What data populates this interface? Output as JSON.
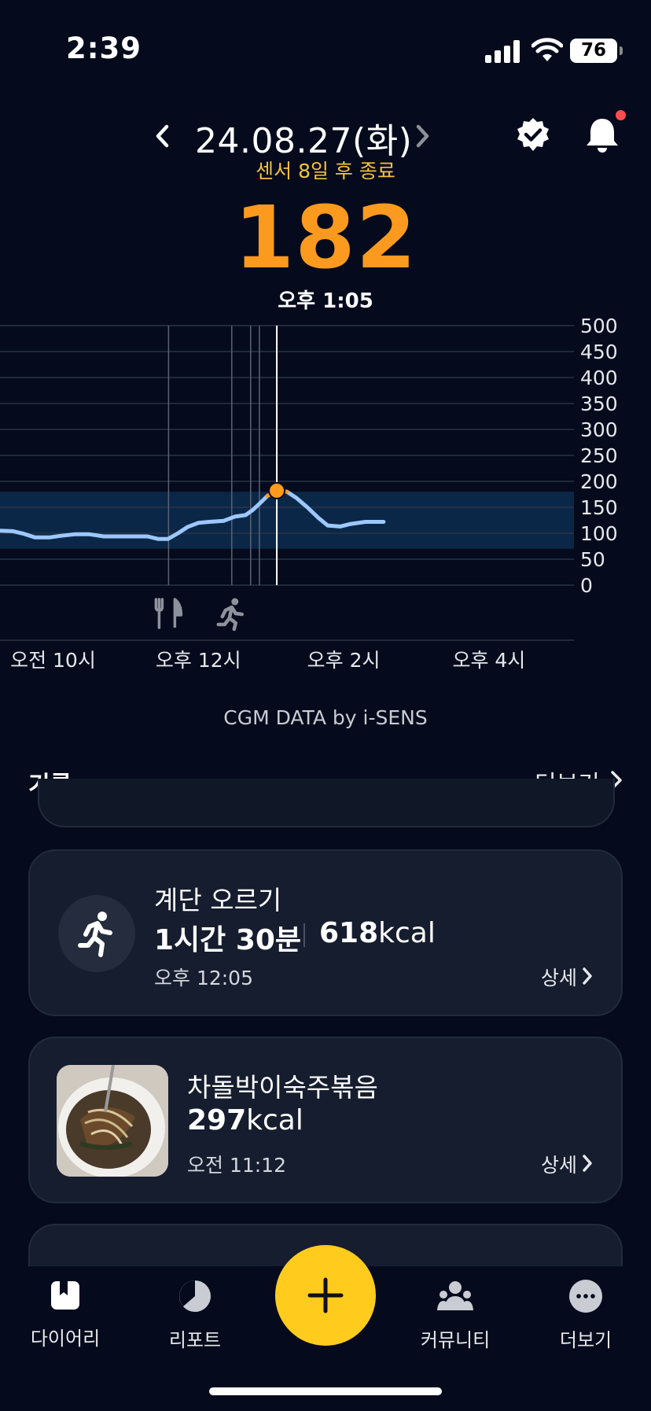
{
  "status_bar": {
    "time": "2:39",
    "battery": "76"
  },
  "header": {
    "date": "24.08.27(화)",
    "sensor_notice": "센서 8일 후 종료",
    "glucose_value": "182",
    "reading_time": "오후 1:05",
    "icons": [
      "chevron-left-icon",
      "chevron-right-icon",
      "verified-badge-icon",
      "bell-icon"
    ],
    "colors": {
      "glucose": "#fb9a1e",
      "sensor_notice": "#f5c13c",
      "notification_dot": "#ff4d4d"
    }
  },
  "chart_data": {
    "type": "line",
    "ylim": [
      0,
      500
    ],
    "yticks": [
      "500",
      "450",
      "400",
      "350",
      "300",
      "250",
      "200",
      "150",
      "100",
      "50",
      "0"
    ],
    "xtick_labels": [
      "오전 10시",
      "오후 12시",
      "오후 2시",
      "오후 4시"
    ],
    "x_domain_hours": [
      9.27,
      17.17
    ],
    "target_range": [
      70,
      180
    ],
    "event_markers": [
      {
        "hour": 11.59,
        "icon": "fork-knife-icon"
      },
      {
        "hour": 12.46,
        "icon": "running-icon"
      }
    ],
    "extra_event_lines_hours": [
      12.72,
      12.84
    ],
    "selected": {
      "hour": 13.08,
      "value": 182
    },
    "series": [
      {
        "points": [
          [
            9.27,
            105
          ],
          [
            9.45,
            104
          ],
          [
            9.6,
            99
          ],
          [
            9.75,
            92
          ],
          [
            9.95,
            92
          ],
          [
            10.1,
            95
          ],
          [
            10.3,
            98
          ],
          [
            10.5,
            98
          ],
          [
            10.7,
            94
          ],
          [
            10.9,
            94
          ],
          [
            11.1,
            94
          ],
          [
            11.3,
            94
          ],
          [
            11.45,
            89
          ],
          [
            11.58,
            89
          ],
          [
            11.72,
            100
          ],
          [
            11.85,
            112
          ],
          [
            12.0,
            120
          ],
          [
            12.15,
            122
          ],
          [
            12.35,
            124
          ],
          [
            12.5,
            132
          ],
          [
            12.65,
            135
          ],
          [
            12.75,
            145
          ],
          [
            12.85,
            158
          ],
          [
            12.95,
            172
          ],
          [
            13.08,
            182
          ],
          [
            13.22,
            180
          ],
          [
            13.35,
            168
          ],
          [
            13.5,
            150
          ],
          [
            13.65,
            130
          ],
          [
            13.78,
            115
          ],
          [
            13.95,
            113
          ],
          [
            14.1,
            118
          ],
          [
            14.3,
            122
          ],
          [
            14.55,
            122
          ]
        ]
      }
    ],
    "colors": {
      "line": "#9cc8ff",
      "target_band": "#0b2748",
      "selected_dot": "#ff9a1e"
    }
  },
  "cgm_credit": "CGM DATA by i-SENS",
  "records": {
    "title": "기록",
    "more_label": "더보기",
    "items": [
      {
        "kind": "exercise",
        "icon": "running-icon",
        "title": "계단 오르기",
        "duration": "1시간 30분",
        "calories_value": "618",
        "calories_unit": "kcal",
        "time": "오후 12:05",
        "detail_label": "상세"
      },
      {
        "kind": "meal",
        "image": "food-photo",
        "title": "차돌박이숙주볶음",
        "calories_value": "297",
        "calories_unit": "kcal",
        "time": "오전 11:12",
        "detail_label": "상세"
      }
    ]
  },
  "bottom_nav": {
    "items": [
      {
        "label": "다이어리",
        "icon": "diary-icon"
      },
      {
        "label": "리포트",
        "icon": "report-pie-icon"
      },
      {
        "label": "커뮤니티",
        "icon": "community-icon"
      },
      {
        "label": "더보기",
        "icon": "more-dots-icon"
      }
    ],
    "add_icon": "plus-icon",
    "fab_color": "#ffcc1e"
  }
}
